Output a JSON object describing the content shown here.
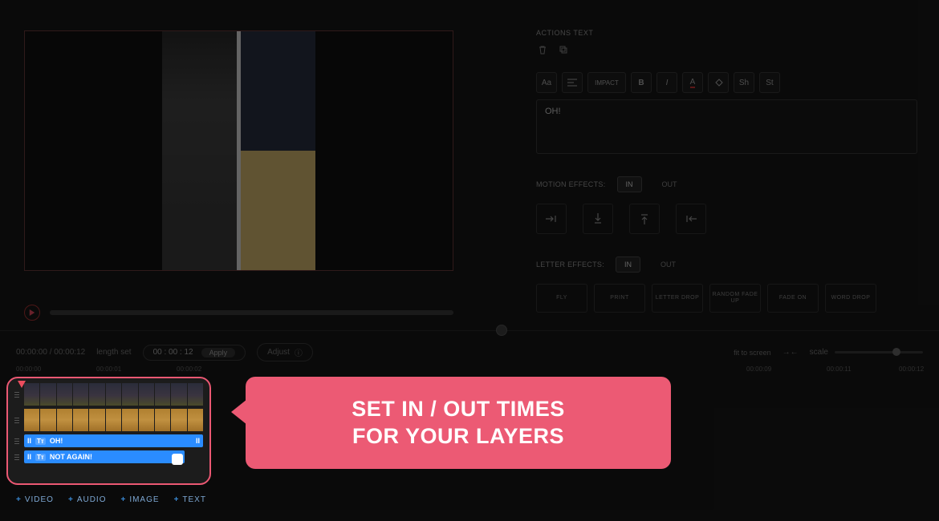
{
  "preview": {},
  "rightPanel": {
    "actionsTitle": "ACTIONS TEXT",
    "toolbar": {
      "aa": "Aa",
      "impact": "IMPACT",
      "bold": "B",
      "italic": "I",
      "underlineA": "A",
      "sh": "Sh",
      "st": "St"
    },
    "textValue": "OH!",
    "motion": {
      "label": "MOTION EFFECTS:",
      "inTab": "IN",
      "outTab": "OUT"
    },
    "letter": {
      "label": "LETTER EFFECTS:",
      "inTab": "IN",
      "outTab": "OUT",
      "options": [
        "FLY",
        "PRINT",
        "LETTER DROP",
        "RANDOM FADE UP",
        "FADE ON",
        "WORD DROP"
      ]
    }
  },
  "lengthBar": {
    "time": "00:00:00 / 00:00:12",
    "label": "length set",
    "input": "00 : 00 : 12",
    "apply": "Apply",
    "adjust": "Adjust",
    "fit": "fit to screen",
    "scale": "scale"
  },
  "ruler": {
    "ticks": [
      "00:00:00",
      "00:00:01",
      "00:00:02",
      "00:00:09",
      "00:00:11",
      "00:00:12"
    ]
  },
  "timeline": {
    "text1": "OH!",
    "text2": "NOT AGAIN!",
    "tt": "Tт",
    "pause": "II"
  },
  "callout": {
    "line1": "SET IN / OUT TIMES",
    "line2": "FOR YOUR LAYERS"
  },
  "addRow": {
    "video": "VIDEO",
    "audio": "AUDIO",
    "image": "IMAGE",
    "text": "TEXT"
  }
}
